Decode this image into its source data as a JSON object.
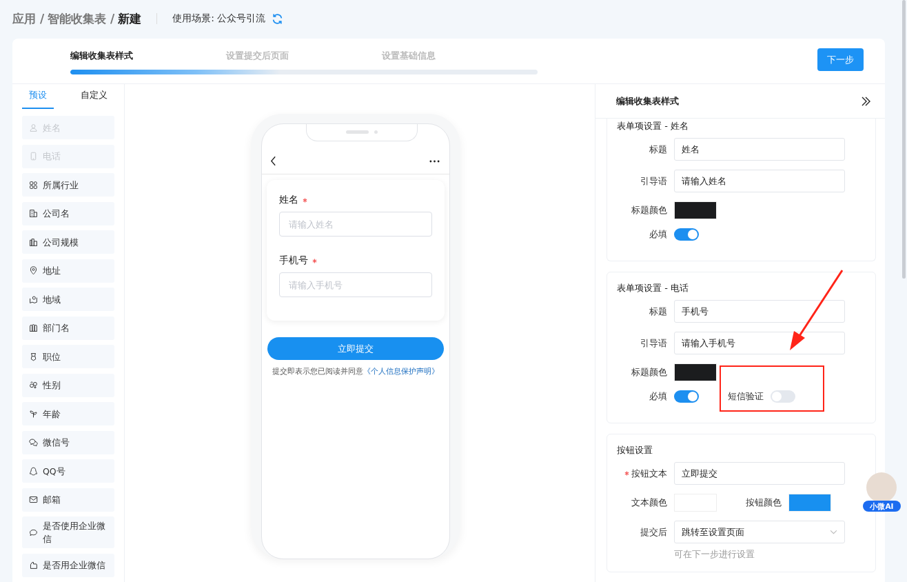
{
  "breadcrumb": [
    {
      "text": "应用 /",
      "current": false
    },
    {
      "text": "智能收集表 /",
      "current": false
    },
    {
      "text": "新建",
      "current": true
    }
  ],
  "scene": "使用场景: 公众号引流",
  "steps": [
    {
      "label": "编辑收集表样式",
      "selected": true
    },
    {
      "label": "设置提交后页面",
      "selected": false
    },
    {
      "label": "设置基础信息",
      "selected": false
    }
  ],
  "progress": {
    "level": 0.45
  },
  "next_button": "下一步",
  "sidebar": {
    "tabs": [
      {
        "label": "预设",
        "selected": true
      },
      {
        "label": "自定义",
        "selected": false
      }
    ],
    "items": [
      {
        "kind": "person",
        "label": "姓名",
        "disabled": true
      },
      {
        "kind": "phone",
        "label": "电话",
        "disabled": true
      },
      {
        "kind": "grid",
        "label": "所属行业",
        "disabled": false
      },
      {
        "kind": "building",
        "label": "公司名",
        "disabled": false
      },
      {
        "kind": "chart",
        "label": "公司规模",
        "disabled": false
      },
      {
        "kind": "pin",
        "label": "地址",
        "disabled": false
      },
      {
        "kind": "map",
        "label": "地域",
        "disabled": false
      },
      {
        "kind": "columns",
        "label": "部门名",
        "disabled": false
      },
      {
        "kind": "medal",
        "label": "职位",
        "disabled": false
      },
      {
        "kind": "gender",
        "label": "性别",
        "disabled": false
      },
      {
        "kind": "sprout",
        "label": "年龄",
        "disabled": false
      },
      {
        "kind": "chat",
        "label": "微信号",
        "disabled": false
      },
      {
        "kind": "penguin",
        "label": "QQ号",
        "disabled": false
      },
      {
        "kind": "mail",
        "label": "邮箱",
        "disabled": false
      },
      {
        "kind": "bubble",
        "label": "是否使用企业微信",
        "disabled": false
      },
      {
        "kind": "hand",
        "label": "是否用企业微信",
        "disabled": false
      }
    ]
  },
  "preview": {
    "fields": [
      {
        "label": "姓名",
        "required": true,
        "placeholder": "请输入姓名"
      },
      {
        "label": "手机号",
        "required": true,
        "placeholder": "请输入手机号"
      }
    ],
    "submit": "立即提交",
    "agreement": "提交即表示您已阅读并同意",
    "link": "《个人信息保护声明》"
  },
  "panel": {
    "title": "编辑收集表样式",
    "sections": [
      {
        "title": "表单项设置 - 姓名",
        "rows": [
          {
            "kind": "text",
            "label": "标题",
            "value": "姓名"
          },
          {
            "kind": "text",
            "label": "引导语",
            "value": "请输入姓名"
          },
          {
            "kind": "color",
            "label": "标题颜色",
            "color": "#1b1c1e"
          },
          {
            "kind": "toggle",
            "label": "必填",
            "on": true
          }
        ]
      },
      {
        "title": "表单项设置 - 电话",
        "rows": [
          {
            "kind": "text",
            "label": "标题",
            "value": "手机号"
          },
          {
            "kind": "text",
            "label": "引导语",
            "value": "请输入手机号"
          },
          {
            "kind": "color",
            "label": "标题颜色",
            "color": "#1b1c1e"
          },
          {
            "kind": "toggle",
            "label": "必填",
            "on": true,
            "extra": {
              "label": "短信验证",
              "on": false
            }
          }
        ]
      },
      {
        "title": "按钮设置",
        "rows": [
          {
            "kind": "text",
            "label": "按钮文本",
            "value": "立即提交",
            "required": true
          },
          {
            "kind": "color",
            "label": "文本颜色",
            "color": "#ffffff",
            "extra": {
              "label": "按钮颜色",
              "color": "#1890f0"
            }
          },
          {
            "kind": "select",
            "label": "提交后",
            "value": "跳转至设置页面",
            "hint": "可在下一步进行设置"
          }
        ]
      }
    ]
  },
  "assistant": {
    "label": "小微AI"
  }
}
